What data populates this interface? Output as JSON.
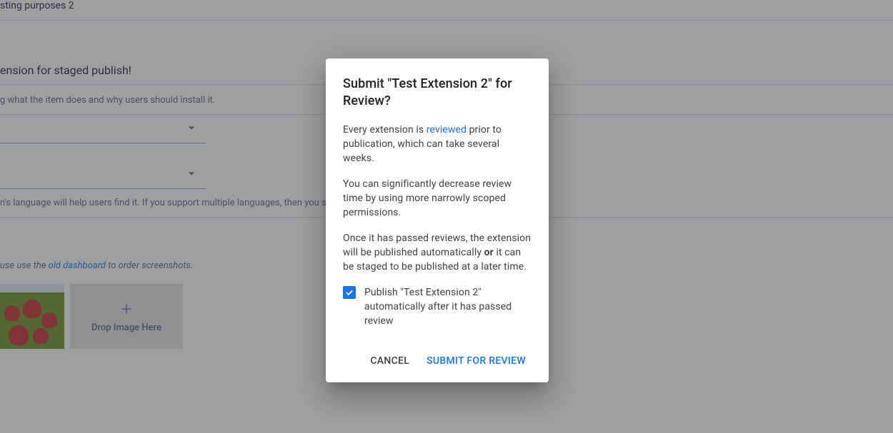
{
  "bg": {
    "title_fragment": "sting purposes 2",
    "staged_heading": "ension for staged publish!",
    "desc_fragment": "g what the item does and why users should install it.",
    "lang_hint": "n's language will help users find it. If you support multiple languages, then you sh",
    "screenshots_note_prefix": "use use the ",
    "old_dashboard_link": "old dashboard",
    "screenshots_note_suffix": " to order screenshots.",
    "dropzone_label": "Drop Image Here"
  },
  "modal": {
    "title": "Submit \"Test Extension 2\" for Review?",
    "p1_a": "Every extension is ",
    "p1_link": "reviewed",
    "p1_b": " prior to publication, which can take several weeks.",
    "p2": "You can significantly decrease review time by using more narrowly scoped permissions.",
    "p3_a": "Once it has passed reviews, the extension will be published automatically ",
    "p3_bold": "or",
    "p3_b": " it can be staged to be published at a later time.",
    "checkbox_label": "Publish \"Test Extension 2\" automatically after it has passed review",
    "checkbox_checked": true,
    "cancel": "Cancel",
    "submit": "Submit for review"
  }
}
